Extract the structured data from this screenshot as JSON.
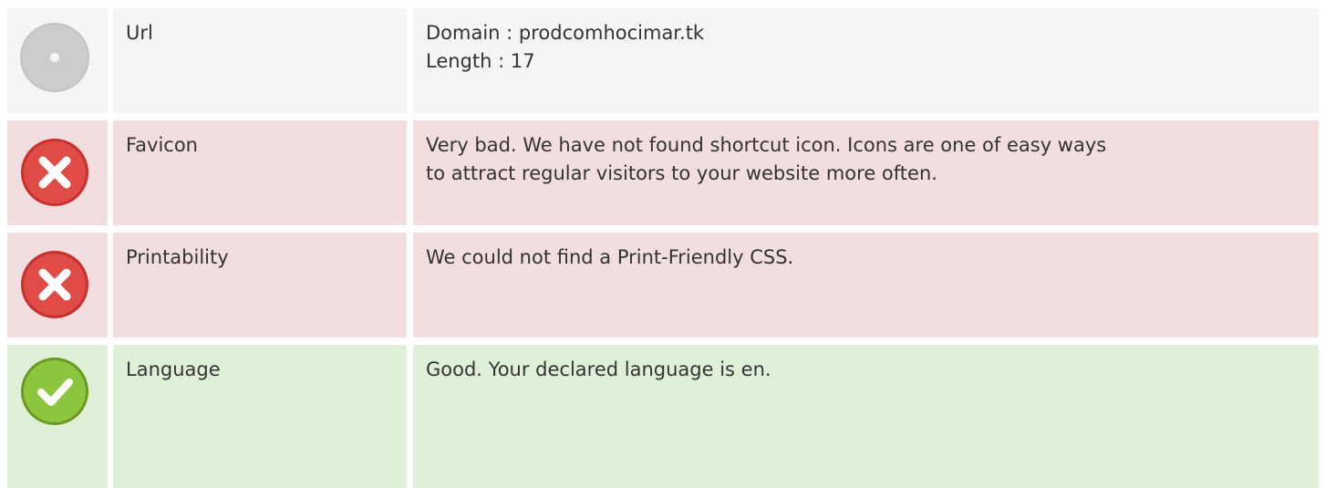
{
  "rows": [
    {
      "status": "neutral",
      "icon": "info-dot-icon",
      "label": "Url",
      "value": "Domain : prodcomhocimar.tk\nLength : 17"
    },
    {
      "status": "bad",
      "icon": "error-cross-icon",
      "label": "Favicon",
      "value": "Very bad. We have not found shortcut icon. Icons are one of easy ways\nto attract regular visitors to your website more often."
    },
    {
      "status": "bad",
      "icon": "error-cross-icon",
      "label": "Printability",
      "value": "We could not find a Print-Friendly CSS."
    },
    {
      "status": "good",
      "icon": "success-check-icon",
      "label": "Language",
      "value": "Good. Your declared language is en."
    }
  ],
  "colors": {
    "neutral_bg": "#f5f5f5",
    "bad_bg": "#f2dede",
    "good_bg": "#dff0d8",
    "error_red": "#d9534f",
    "success_green": "#8cc63f",
    "neutral_gray": "#c8c8c8"
  }
}
